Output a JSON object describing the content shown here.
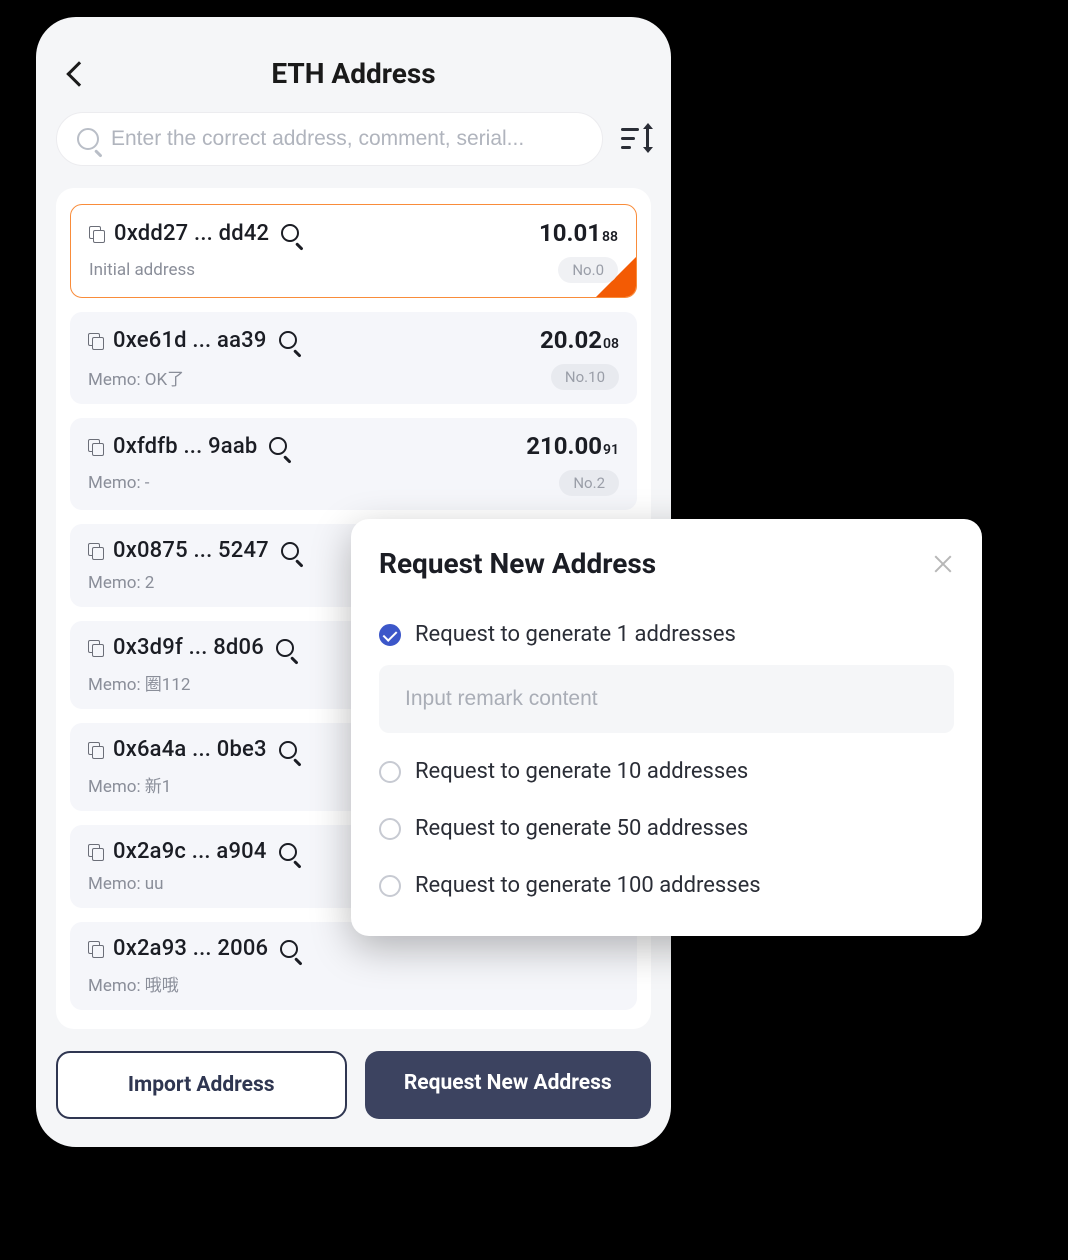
{
  "header": {
    "title": "ETH Address"
  },
  "search": {
    "placeholder": "Enter the correct address, comment, serial..."
  },
  "addresses": [
    {
      "addr": "0xdd27 ... dd42",
      "balance_main": "10.01",
      "balance_sub": "88",
      "memo": "Initial address",
      "no": "No.0",
      "active": true
    },
    {
      "addr": "0xe61d ... aa39",
      "balance_main": "20.02",
      "balance_sub": "08",
      "memo": "Memo: OK了",
      "no": "No.10",
      "active": false
    },
    {
      "addr": "0xfdfb ... 9aab",
      "balance_main": "210.00",
      "balance_sub": "91",
      "memo": "Memo: -",
      "no": "No.2",
      "active": false
    },
    {
      "addr": "0x0875 ... 5247",
      "balance_main": "",
      "balance_sub": "",
      "memo": "Memo: 2",
      "no": "",
      "active": false
    },
    {
      "addr": "0x3d9f ... 8d06",
      "balance_main": "",
      "balance_sub": "",
      "memo": "Memo: 圈112",
      "no": "",
      "active": false
    },
    {
      "addr": "0x6a4a ... 0be3",
      "balance_main": "",
      "balance_sub": "",
      "memo": "Memo: 新1",
      "no": "",
      "active": false
    },
    {
      "addr": "0x2a9c ... a904",
      "balance_main": "",
      "balance_sub": "",
      "memo": "Memo: uu",
      "no": "",
      "active": false
    },
    {
      "addr": "0x2a93 ... 2006",
      "balance_main": "",
      "balance_sub": "",
      "memo": "Memo: 哦哦",
      "no": "",
      "active": false
    }
  ],
  "buttons": {
    "import": "Import Address",
    "request": "Request New Address"
  },
  "modal": {
    "title": "Request New Address",
    "remark_placeholder": "Input remark content",
    "options": [
      {
        "label": "Request to generate 1 addresses",
        "checked": true
      },
      {
        "label": "Request to generate 10 addresses",
        "checked": false
      },
      {
        "label": "Request to generate 50 addresses",
        "checked": false
      },
      {
        "label": "Request to generate 100 addresses",
        "checked": false
      }
    ]
  }
}
